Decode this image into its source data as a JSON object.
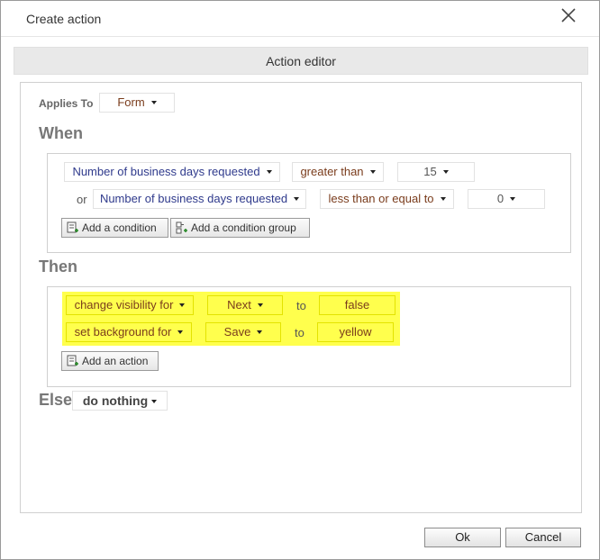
{
  "dialog": {
    "title": "Create action",
    "close_icon": "close-icon"
  },
  "editor": {
    "header": "Action editor"
  },
  "applies": {
    "label": "Applies To",
    "value": "Form"
  },
  "when": {
    "heading": "When",
    "conditions": [
      {
        "field": "Number of business days requested",
        "operator": "greater than",
        "value": "15"
      },
      {
        "connector": "or",
        "field": "Number of business days requested",
        "operator": "less than or equal to",
        "value": "0"
      }
    ],
    "add_condition": "Add a condition",
    "add_condition_group": "Add a condition group"
  },
  "then": {
    "heading": "Then",
    "actions": [
      {
        "action": "change visibility for",
        "target": "Next",
        "to": "to",
        "value": "false"
      },
      {
        "action": "set background for",
        "target": "Save",
        "to": "to",
        "value": "yellow"
      }
    ],
    "add_action": "Add an action",
    "highlight_color": "#ffff4d"
  },
  "else": {
    "heading": "Else",
    "value": "do nothing"
  },
  "footer": {
    "ok": "Ok",
    "cancel": "Cancel"
  }
}
